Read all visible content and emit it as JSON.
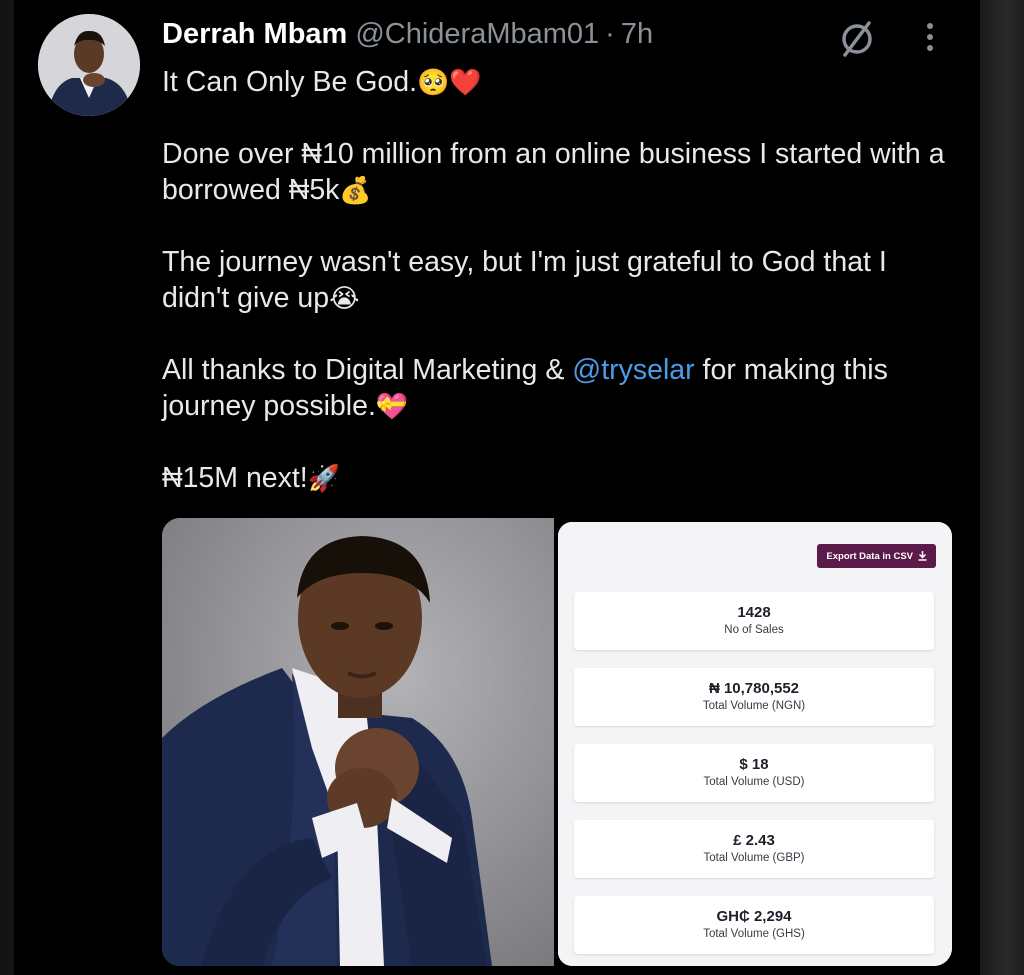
{
  "tweet": {
    "author_name": "Derrah Mbam",
    "handle": "@ChideraMbam01",
    "separator": "·",
    "time": "7h",
    "lines": {
      "p1": "It Can Only Be God.",
      "p1_emoji": "🥺❤️",
      "p2": "Done over ₦10 million from an online business I started with a borrowed ₦5k",
      "p2_emoji": "💰",
      "p3": "The journey wasn't easy, but I'm just grateful to God that I didn't give up",
      "p3_emoji": "😭",
      "p4_before": "All thanks to Digital Marketing & ",
      "p4_mention": "@tryselar",
      "p4_after": " for making this journey possible.",
      "p4_emoji": "💝",
      "p5": "₦15M next!",
      "p5_emoji": "🚀"
    }
  },
  "icons": {
    "grok": "grok-icon",
    "more": "more-vertical-icon",
    "download": "download-icon"
  },
  "colors": {
    "mention": "#4a9be8",
    "export_button": "#5a1b4a"
  },
  "dashboard": {
    "export_label": "Export Data in CSV",
    "stats": [
      {
        "value": "1428",
        "label": "No of Sales"
      },
      {
        "value": "₦ 10,780,552",
        "label": "Total Volume (NGN)"
      },
      {
        "value": "$ 18",
        "label": "Total Volume (USD)"
      },
      {
        "value": "£ 2.43",
        "label": "Total Volume (GBP)"
      },
      {
        "value": "GH₵ 2,294",
        "label": "Total Volume (GHS)"
      }
    ]
  }
}
